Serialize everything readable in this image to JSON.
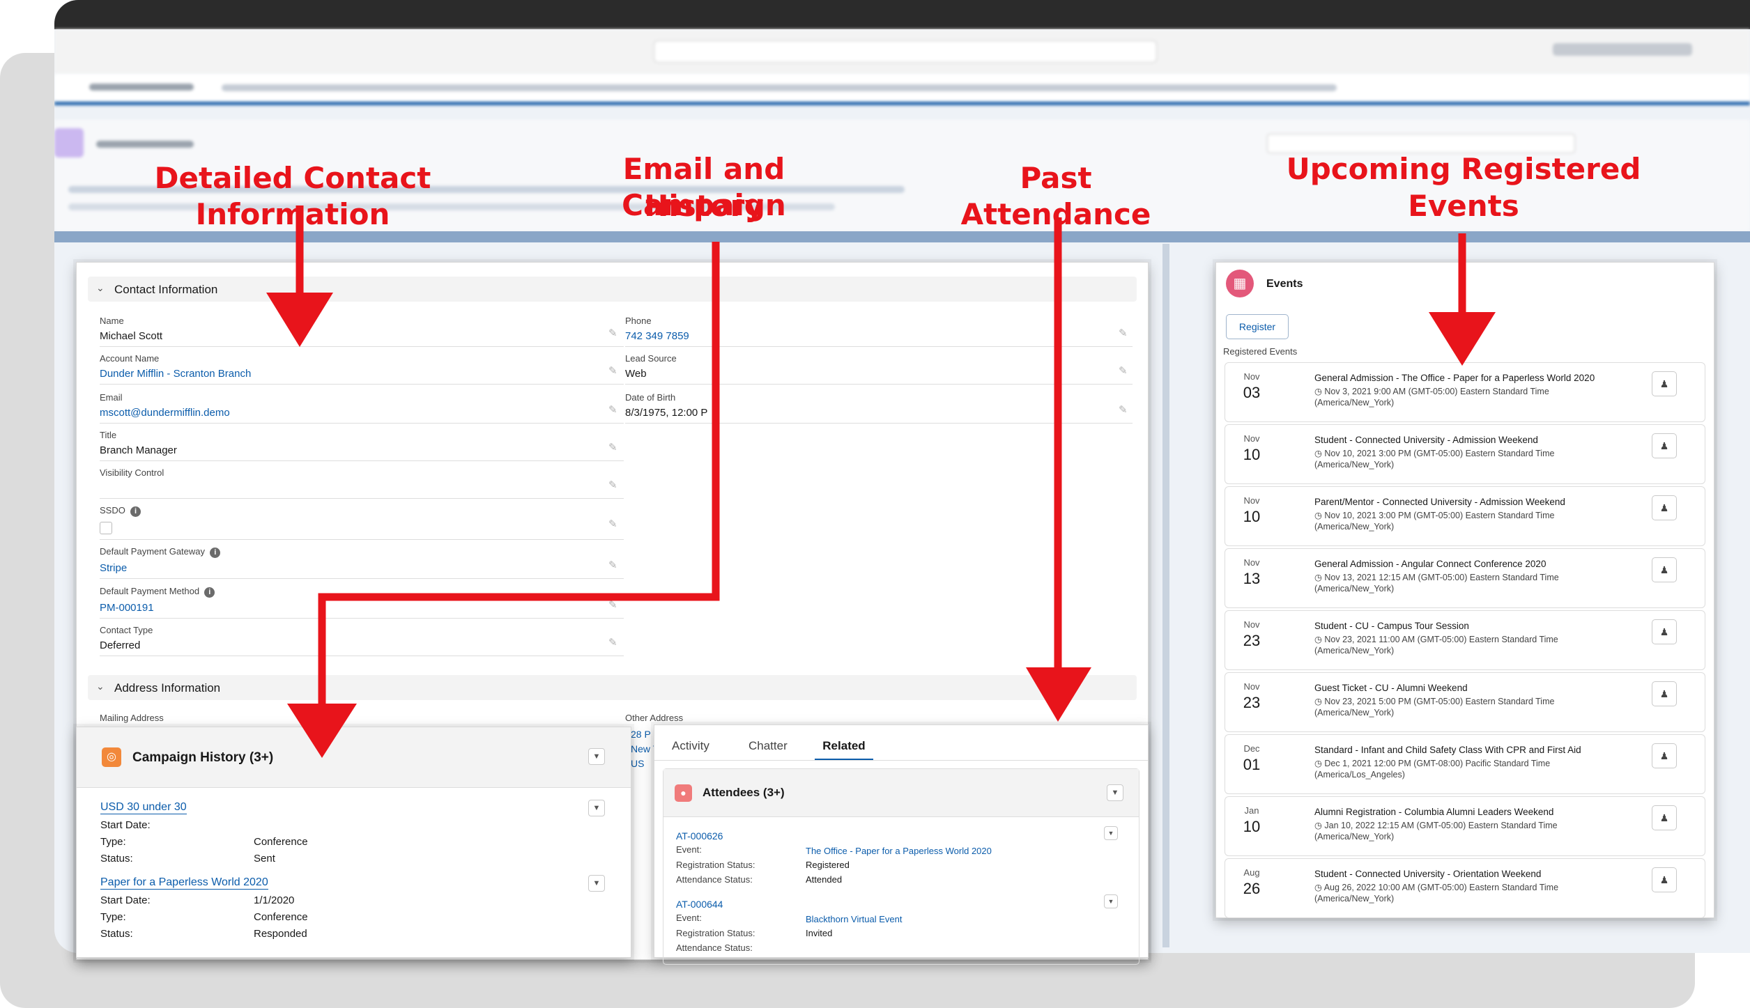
{
  "callouts": {
    "contact": "Detailed Contact Information",
    "campaign_l1": "Email and Campaign",
    "campaign_l2": "History",
    "past": "Past Attendance",
    "upcoming_l1": "Upcoming Registered",
    "upcoming_l2": "Events"
  },
  "contact_info": {
    "section_title": "Contact Information",
    "fields": {
      "name_label": "Name",
      "name_value": "Michael Scott",
      "account_label": "Account Name",
      "account_value": "Dunder Mifflin - Scranton Branch",
      "email_label": "Email",
      "email_value": "mscott@dundermifflin.demo",
      "title_label": "Title",
      "title_value": "Branch Manager",
      "visibility_label": "Visibility Control",
      "ssdo_label": "SSDO",
      "gateway_label": "Default Payment Gateway",
      "gateway_value": "Stripe",
      "method_label": "Default Payment Method",
      "method_value": "PM-000191",
      "contact_type_label": "Contact Type",
      "contact_type_value": "Deferred",
      "phone_label": "Phone",
      "phone_value": "742 349 7859",
      "lead_source_label": "Lead Source",
      "lead_source_value": "Web",
      "dob_label": "Date of Birth",
      "dob_value": "8/3/1975, 12:00 P"
    }
  },
  "address_info": {
    "section_title": "Address Information",
    "mailing_label": "Mailing Address",
    "other_label": "Other Address",
    "other_partial": [
      "28 P",
      "New Y",
      "US"
    ]
  },
  "campaign_history": {
    "title": "Campaign History (3+)",
    "items": [
      {
        "name": "USD 30 under 30",
        "start_date_label": "Start Date:",
        "start_date": "",
        "type_label": "Type:",
        "type": "Conference",
        "status_label": "Status:",
        "status": "Sent"
      },
      {
        "name": "Paper for a Paperless World 2020",
        "start_date_label": "Start Date:",
        "start_date": "1/1/2020",
        "type_label": "Type:",
        "type": "Conference",
        "status_label": "Status:",
        "status": "Responded"
      }
    ]
  },
  "tabs": [
    "Activity",
    "Chatter",
    "Related"
  ],
  "attendees": {
    "title": "Attendees (3+)",
    "items": [
      {
        "id": "AT-000626",
        "event_label": "Event:",
        "event": "The Office - Paper for a Paperless World 2020",
        "reg_label": "Registration Status:",
        "reg": "Registered",
        "att_label": "Attendance Status:",
        "att": "Attended"
      },
      {
        "id": "AT-000644",
        "event_label": "Event:",
        "event": "Blackthorn Virtual Event",
        "reg_label": "Registration Status:",
        "reg": "Invited",
        "att_label": "Attendance Status:",
        "att": ""
      }
    ]
  },
  "events_panel": {
    "title": "Events",
    "register_button": "Register",
    "registered_label": "Registered Events",
    "events": [
      {
        "month": "Nov",
        "day": "03",
        "name": "General Admission - The Office - Paper for a Paperless World 2020",
        "date": "Nov 3, 2021 9:00 AM (GMT-05:00) Eastern Standard Time",
        "tz": "(America/New_York)"
      },
      {
        "month": "Nov",
        "day": "10",
        "name": "Student - Connected University - Admission Weekend",
        "date": "Nov 10, 2021 3:00 PM (GMT-05:00) Eastern Standard Time",
        "tz": "(America/New_York)"
      },
      {
        "month": "Nov",
        "day": "10",
        "name": "Parent/Mentor - Connected University - Admission Weekend",
        "date": "Nov 10, 2021 3:00 PM (GMT-05:00) Eastern Standard Time",
        "tz": "(America/New_York)"
      },
      {
        "month": "Nov",
        "day": "13",
        "name": "General Admission - Angular Connect Conference 2020",
        "date": "Nov 13, 2021 12:15 AM (GMT-05:00) Eastern Standard Time",
        "tz": "(America/New_York)"
      },
      {
        "month": "Nov",
        "day": "23",
        "name": "Student - CU - Campus Tour Session",
        "date": "Nov 23, 2021 11:00 AM (GMT-05:00) Eastern Standard Time",
        "tz": "(America/New_York)"
      },
      {
        "month": "Nov",
        "day": "23",
        "name": "Guest Ticket - CU - Alumni Weekend",
        "date": "Nov 23, 2021 5:00 PM (GMT-05:00) Eastern Standard Time",
        "tz": "(America/New_York)"
      },
      {
        "month": "Dec",
        "day": "01",
        "name": "Standard - Infant and Child Safety Class With CPR and First Aid",
        "date": "Dec 1, 2021 12:00 PM (GMT-08:00) Pacific Standard Time",
        "tz": "(America/Los_Angeles)"
      },
      {
        "month": "Jan",
        "day": "10",
        "name": "Alumni Registration - Columbia Alumni Leaders Weekend",
        "date": "Jan 10, 2022 12:15 AM (GMT-05:00) Eastern Standard Time",
        "tz": "(America/New_York)"
      },
      {
        "month": "Aug",
        "day": "26",
        "name": "Student - Connected University - Orientation Weekend",
        "date": "Aug 26, 2022 10:00 AM (GMT-05:00) Eastern Standard Time",
        "tz": "(America/New_York)"
      }
    ]
  },
  "colors": {
    "callout": "#e8141b",
    "link": "#0b5cab",
    "campaign_icon": "#f2883a",
    "attendees_icon": "#f07b7b",
    "events_icon": "#e3587a"
  },
  "icons": [
    "chevron-down-icon",
    "pencil-icon",
    "info-icon",
    "campaign-icon",
    "attendees-icon",
    "calendar-icon",
    "clock-icon",
    "unregister-icon",
    "dropdown-icon"
  ]
}
